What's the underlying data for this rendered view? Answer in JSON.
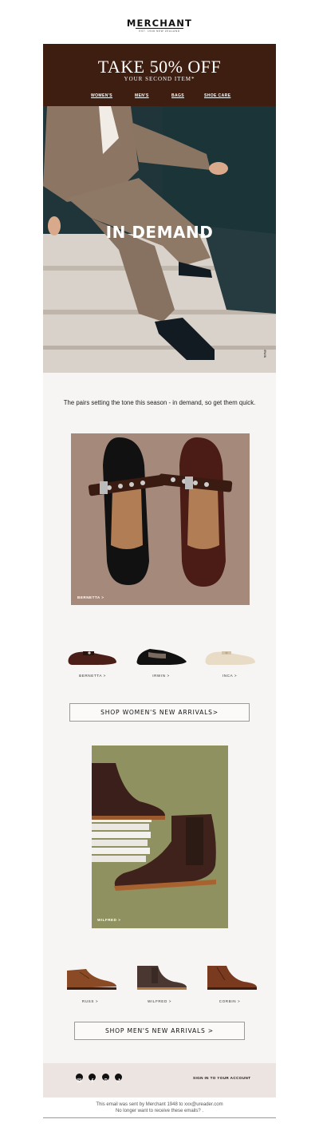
{
  "header": {
    "logo": "MERCHANT",
    "logo_sub": "EST. 1948 NEW ZEALAND"
  },
  "promo": {
    "title": "TAKE 50% OFF",
    "subtitle": "YOUR SECOND ITEM*",
    "nav": [
      "WOMEN'S",
      "MEN'S",
      "BAGS",
      "SHOE CARE"
    ],
    "background": "#3e1e10"
  },
  "hero": {
    "title": "IN DEMAND",
    "tag": "IRWIN"
  },
  "intro": "The pairs setting the tone this season -  in demand, so get them quick.",
  "womens": {
    "feature_label": "BERNETTA >",
    "thumbs": [
      "BERNETTA >",
      "IRWIN >",
      "INCA >"
    ],
    "button": "SHOP WOMEN'S NEW ARRIVALS>"
  },
  "mens": {
    "feature_label": "WILFRED >",
    "thumbs": [
      "RUSS >",
      "WILFRED >",
      "CORBIN >"
    ],
    "button": "SHOP MEN'S NEW ARRIVALS >"
  },
  "footer": {
    "social_icons": [
      "instagram-icon",
      "facebook-icon",
      "pinterest-icon",
      "tiktok-icon"
    ],
    "signin": "SIGN IN TO YOUR ACCOUNT",
    "sent_line": "This email was sent by Merchant 1948 to xxx@ureader.com",
    "unsubscribe_line": "No longer want to receive these emails? ."
  }
}
